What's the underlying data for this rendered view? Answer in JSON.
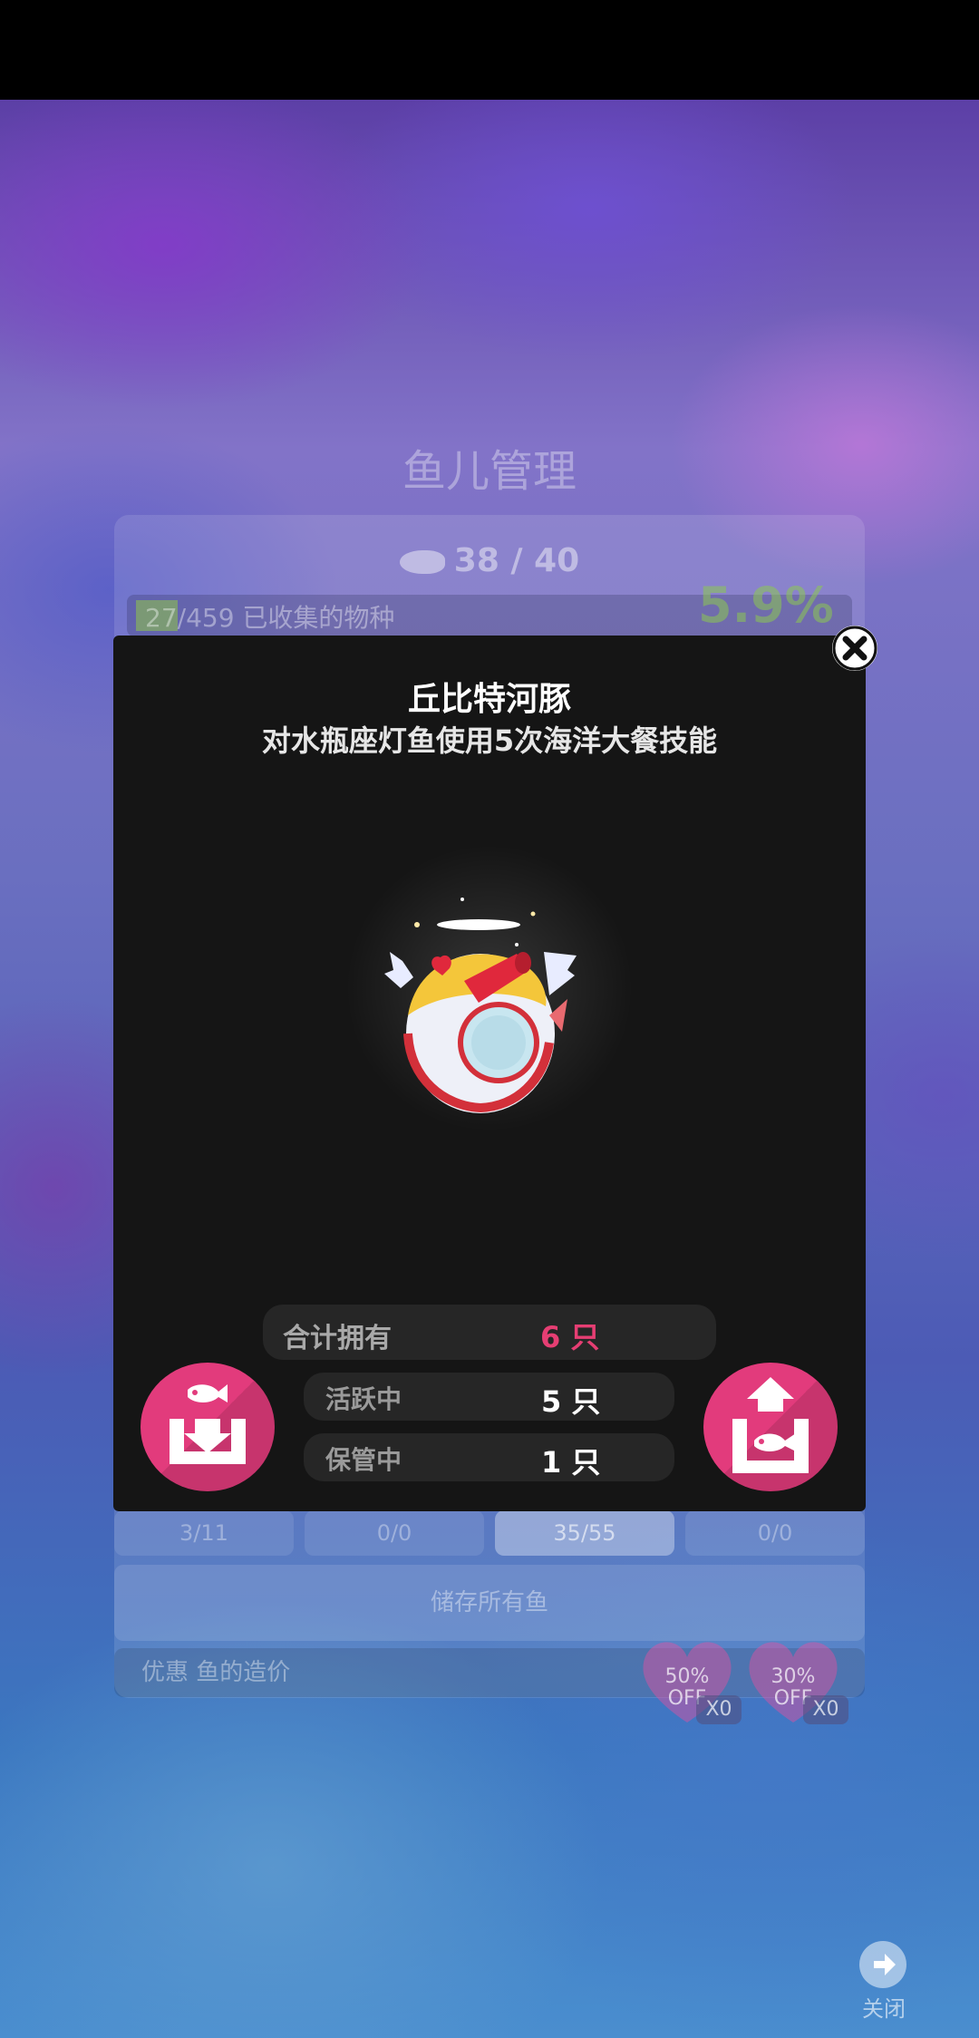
{
  "background": {
    "title": "鱼儿管理",
    "fish_count": "38 / 40",
    "collected_current": "27",
    "collected_rest": "/459 已收集的物种",
    "percent": "5.9%",
    "tabs": [
      "3/11",
      "0/0",
      "35/55",
      "0/0"
    ],
    "active_tab_index": 2,
    "store_all": "储存所有鱼",
    "discount_label": "优惠 鱼的造价",
    "coupons": [
      {
        "label": "50%\nOFF",
        "count": "X0"
      },
      {
        "label": "30%\nOFF",
        "count": "X0"
      }
    ],
    "close_label": "关闭"
  },
  "modal": {
    "fish_name": "丘比特河豚",
    "description": "对水瓶座灯鱼使用5次海洋大餐技能",
    "total_label": "合计拥有",
    "total_value": "6 只",
    "active_label": "活跃中",
    "active_value": "5 只",
    "stored_label": "保管中",
    "stored_value": "1 只"
  },
  "colors": {
    "accent_pink": "#e23b7c",
    "total_value": "#e63e73",
    "modal_bg": "#151515",
    "percent_green": "#8cc850"
  }
}
